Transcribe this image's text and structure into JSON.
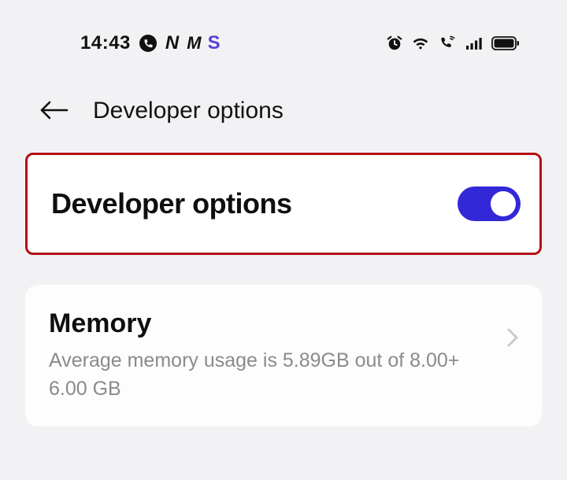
{
  "status_bar": {
    "time": "14:43"
  },
  "header": {
    "title": "Developer options"
  },
  "toggle_card": {
    "title": "Developer options",
    "enabled": true
  },
  "memory_card": {
    "title": "Memory",
    "description": "Average memory usage is 5.89GB out of 8.00+ 6.00 GB"
  },
  "colors": {
    "accent": "#3328d8",
    "highlight_border": "#b40e14"
  }
}
